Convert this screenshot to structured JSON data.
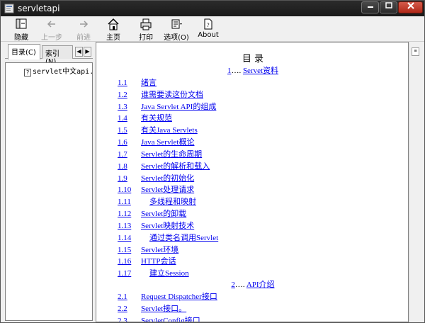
{
  "window": {
    "title": "servletapi"
  },
  "toolbar": {
    "buttons": [
      {
        "label": "隐藏",
        "icon": "hide-pane-icon"
      },
      {
        "label": "上一步",
        "icon": "back-arrow-icon"
      },
      {
        "label": "前进",
        "icon": "forward-arrow-icon"
      },
      {
        "label": "主页",
        "icon": "home-icon"
      },
      {
        "label": "打印",
        "icon": "print-icon"
      },
      {
        "label": "选项(O)",
        "icon": "options-icon"
      },
      {
        "label": "About",
        "icon": "about-doc-icon"
      }
    ]
  },
  "leftpane": {
    "tabs": [
      {
        "label": "目录(C)"
      },
      {
        "label": "索引(N)"
      }
    ],
    "tree": [
      {
        "label": "servlet中文api."
      }
    ]
  },
  "content": {
    "heading": "目 录",
    "sections": [
      {
        "num": "1",
        "sep": "….",
        "title": "Servet资料"
      },
      {
        "num": "2",
        "sep": "….",
        "title": "API介绍"
      }
    ],
    "items": [
      {
        "num": "1.1",
        "title": "绪言",
        "indent": false
      },
      {
        "num": "1.2",
        "title": "谁需要读这份文档",
        "indent": false
      },
      {
        "num": "1.3",
        "title": "Java Servlet API的组成",
        "indent": false
      },
      {
        "num": "1.4",
        "title": "有关规范",
        "indent": false
      },
      {
        "num": "1.5",
        "title": "有关Java Servlets",
        "indent": false
      },
      {
        "num": "1.6",
        "title": "Java Servlet概论",
        "indent": false
      },
      {
        "num": "1.7",
        "title": "Servlet的生命周期",
        "indent": false
      },
      {
        "num": "1.8",
        "title": "Servlet的解析和载入",
        "indent": false
      },
      {
        "num": "1.9",
        "title": "Servlet的初始化",
        "indent": false
      },
      {
        "num": "1.10",
        "title": "Servlet处理请求",
        "indent": false
      },
      {
        "num": "1.11",
        "title": "多线程和映射",
        "indent": true
      },
      {
        "num": "1.12",
        "title": "Servlet的卸载",
        "indent": false
      },
      {
        "num": "1.13",
        "title": "Servlet映射技术",
        "indent": false
      },
      {
        "num": "1.14",
        "title": "通过类名调用Servlet",
        "indent": true
      },
      {
        "num": "1.15",
        "title": "Servlet环境",
        "indent": false
      },
      {
        "num": "1.16",
        "title": "HTTP会话",
        "indent": false
      },
      {
        "num": "1.17",
        "title": "建立Session",
        "indent": true
      },
      {
        "num": "2.1",
        "title": "Request Dispatcher接口",
        "indent": false
      },
      {
        "num": "2.2",
        "title": "Servlet接口。",
        "indent": false
      },
      {
        "num": "2.3",
        "title": "ServletConfig接口",
        "indent": false
      }
    ]
  }
}
